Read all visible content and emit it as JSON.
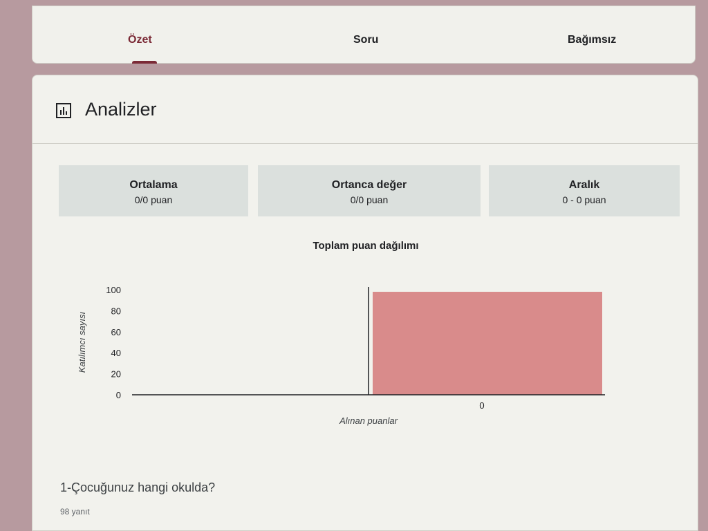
{
  "tabs": [
    {
      "label": "Özet",
      "active": true
    },
    {
      "label": "Soru",
      "active": false
    },
    {
      "label": "Bağımsız",
      "active": false
    }
  ],
  "section": {
    "title": "Analizler",
    "icon": "bar-chart-icon"
  },
  "stats": [
    {
      "label": "Ortalama",
      "value": "0/0 puan"
    },
    {
      "label": "Ortanca değer",
      "value": "0/0 puan"
    },
    {
      "label": "Aralık",
      "value": "0 - 0 puan"
    }
  ],
  "chart_data": {
    "type": "bar",
    "title": "Toplam puan dağılımı",
    "xlabel": "Alınan puanlar",
    "ylabel": "Katılımcı sayısı",
    "categories": [
      "0"
    ],
    "values": [
      98
    ],
    "ylim": [
      0,
      100
    ],
    "yticks": [
      0,
      20,
      40,
      60,
      80,
      100
    ],
    "grid": false,
    "color": "#d98b8b"
  },
  "question": {
    "text": "1-Çocuğunuz hangi okulda?",
    "responses": "98 yanıt"
  }
}
